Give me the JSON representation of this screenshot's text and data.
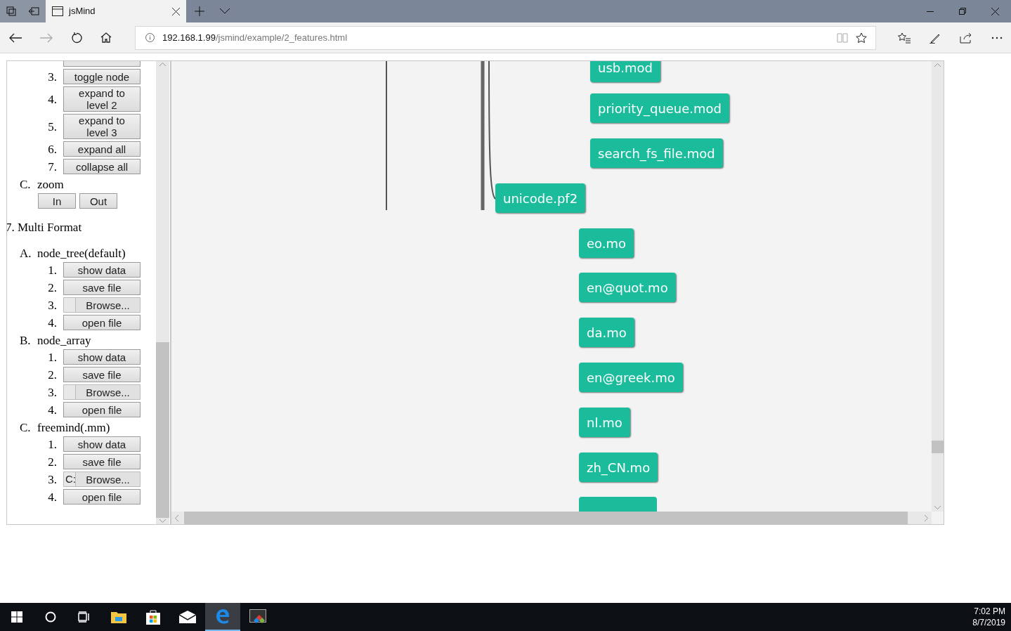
{
  "browser": {
    "tab_title": "jsMind",
    "address_host": "192.168.1.99",
    "address_path": "/jsmind/example/2_features.html"
  },
  "sidebar": {
    "items": [
      {
        "kind": "button",
        "number": "3.",
        "label": "toggle node"
      },
      {
        "kind": "button",
        "number": "4.",
        "label": "expand to level 2"
      },
      {
        "kind": "button",
        "number": "5.",
        "label": "expand to level 3"
      },
      {
        "kind": "button",
        "number": "6.",
        "label": "expand all"
      },
      {
        "kind": "button",
        "number": "7.",
        "label": "collapse all"
      },
      {
        "kind": "group",
        "number": "C.",
        "label": "zoom"
      },
      {
        "kind": "pair",
        "buttons": [
          "In",
          "Out"
        ]
      },
      {
        "kind": "heading",
        "label": "7. Multi Format"
      },
      {
        "kind": "group",
        "number": "A.",
        "label": "node_tree(default)"
      },
      {
        "kind": "button",
        "number": "1.",
        "label": "show data"
      },
      {
        "kind": "button",
        "number": "2.",
        "label": "save file"
      },
      {
        "kind": "file",
        "number": "3.",
        "label": "Browse..."
      },
      {
        "kind": "button",
        "number": "4.",
        "label": "open file"
      },
      {
        "kind": "group",
        "number": "B.",
        "label": "node_array"
      },
      {
        "kind": "button",
        "number": "1.",
        "label": "show data"
      },
      {
        "kind": "button",
        "number": "2.",
        "label": "save file"
      },
      {
        "kind": "file",
        "number": "3.",
        "label": "Browse..."
      },
      {
        "kind": "button",
        "number": "4.",
        "label": "open file"
      },
      {
        "kind": "group",
        "number": "C.",
        "label": "freemind(.mm)"
      },
      {
        "kind": "button",
        "number": "1.",
        "label": "show data"
      },
      {
        "kind": "button",
        "number": "2.",
        "label": "save file"
      },
      {
        "kind": "file",
        "number": "3.",
        "path": "C:",
        "label": "Browse..."
      },
      {
        "kind": "button",
        "number": "4.",
        "label": "open file"
      }
    ]
  },
  "mindmap": {
    "nodes": [
      {
        "label": "usb.mod"
      },
      {
        "label": "priority_queue.mod"
      },
      {
        "label": "search_fs_file.mod"
      },
      {
        "label": "unicode.pf2"
      },
      {
        "label": "eo.mo"
      },
      {
        "label": "en@quot.mo"
      },
      {
        "label": "da.mo"
      },
      {
        "label": "en@greek.mo"
      },
      {
        "label": "nl.mo"
      },
      {
        "label": "zh_CN.mo"
      }
    ]
  },
  "taskbar": {
    "time": "7:02 PM",
    "date": "8/7/2019"
  }
}
